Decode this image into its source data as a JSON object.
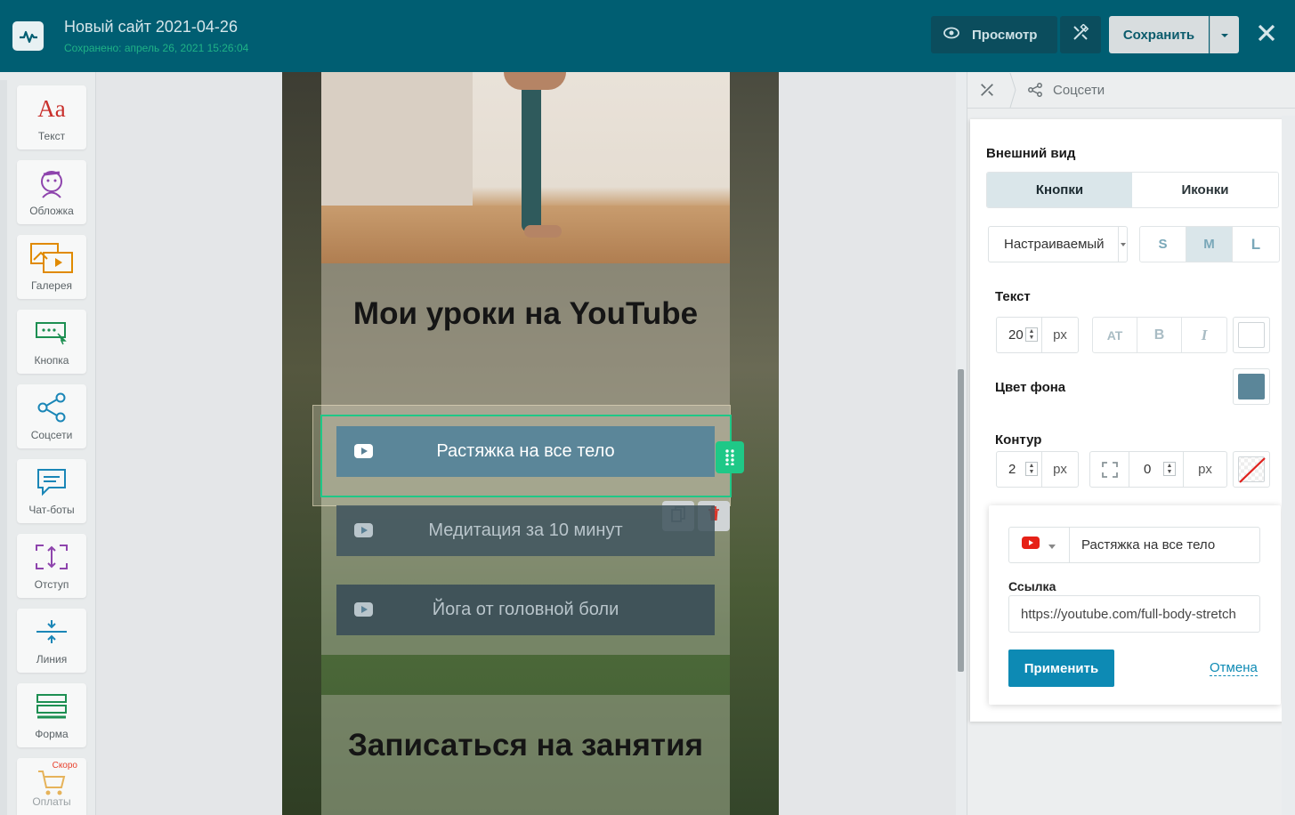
{
  "header": {
    "site_title": "Новый сайт 2021-04-26",
    "saved_status": "Сохранено: апрель 26, 2021 15:26:04",
    "preview_label": "Просмотр",
    "save_label": "Сохранить"
  },
  "toolbar": {
    "items": [
      {
        "label": "Текст",
        "icon": "text-icon"
      },
      {
        "label": "Обложка",
        "icon": "cover-icon"
      },
      {
        "label": "Галерея",
        "icon": "gallery-icon"
      },
      {
        "label": "Кнопка",
        "icon": "button-icon"
      },
      {
        "label": "Соцсети",
        "icon": "social-icon"
      },
      {
        "label": "Чат-боты",
        "icon": "chatbot-icon"
      },
      {
        "label": "Отступ",
        "icon": "spacing-icon"
      },
      {
        "label": "Линия",
        "icon": "line-icon"
      },
      {
        "label": "Форма",
        "icon": "form-icon"
      },
      {
        "label": "Оплаты",
        "icon": "cart-icon",
        "badge": "Скоро"
      }
    ],
    "text_glyph": "Aa"
  },
  "canvas": {
    "heading": "Мои уроки на YouTube",
    "buttons": [
      "Растяжка на все тело",
      "Медитация за 10 минут",
      "Йога от головной боли"
    ],
    "heading2": "Записаться на занятия"
  },
  "panel": {
    "breadcrumb": "Соцсети",
    "appearance_title": "Внешний вид",
    "style_tabs": [
      "Кнопки",
      "Иконки"
    ],
    "active_style_tab": "Кнопки",
    "preset": "Настраиваемый",
    "sizes": [
      "S",
      "M",
      "L"
    ],
    "active_size": "M",
    "text_title": "Текст",
    "text_size": "20",
    "unit": "px",
    "format_buttons": [
      "AT",
      "B",
      "I"
    ],
    "text_color": "#ffffff",
    "bg_title": "Цвет фона",
    "bg_color": "#5b8699",
    "border_title": "Контур",
    "border_width": "2",
    "border_radius": "0",
    "link_card": {
      "network_name": "Растяжка на все тело",
      "link_label": "Ссылка",
      "link_value": "https://youtube.com/full-body-stretch",
      "apply_label": "Применить",
      "cancel_label": "Отмена"
    }
  },
  "colors": {
    "topbar": "#005e72",
    "accent_green": "#1fc887",
    "accent_blue": "#0d8ab4",
    "youtube_red": "#e62117"
  }
}
